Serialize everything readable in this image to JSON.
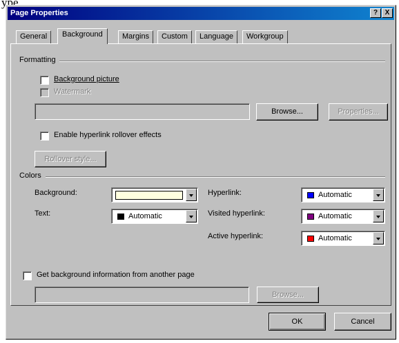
{
  "page_top_text": "ype",
  "dialog": {
    "title": "Page Properties",
    "help_btn": "?",
    "close_btn": "X"
  },
  "tabs": [
    {
      "label": "General"
    },
    {
      "label": "Background"
    },
    {
      "label": "Margins"
    },
    {
      "label": "Custom"
    },
    {
      "label": "Language"
    },
    {
      "label": "Workgroup"
    }
  ],
  "active_tab": "Background",
  "formatting": {
    "group_label": "Formatting",
    "bg_picture": {
      "label": "Background picture",
      "checked": false
    },
    "watermark": {
      "label": "Watermark",
      "checked": false,
      "disabled": true
    },
    "picture_path": "",
    "browse_label": "Browse...",
    "properties_label": "Properties...",
    "rollover": {
      "label": "Enable hyperlink rollover effects",
      "checked": false
    },
    "rollover_style_label": "Rollover style..."
  },
  "colors": {
    "group_label": "Colors",
    "background": {
      "label": "Background:",
      "value": "",
      "swatch": "#ffffe0"
    },
    "text": {
      "label": "Text:",
      "value": "Automatic",
      "swatch": "#000000"
    },
    "hyperlink": {
      "label": "Hyperlink:",
      "value": "Automatic",
      "swatch": "#0000ff"
    },
    "visited": {
      "label": "Visited hyperlink:",
      "value": "Automatic",
      "swatch": "#800080"
    },
    "active": {
      "label": "Active hyperlink:",
      "value": "Automatic",
      "swatch": "#ff0000"
    }
  },
  "get_bg": {
    "label": "Get background information from another page",
    "checked": false
  },
  "get_bg_path": "",
  "get_bg_browse": "Browse...",
  "ok_label": "OK",
  "cancel_label": "Cancel"
}
